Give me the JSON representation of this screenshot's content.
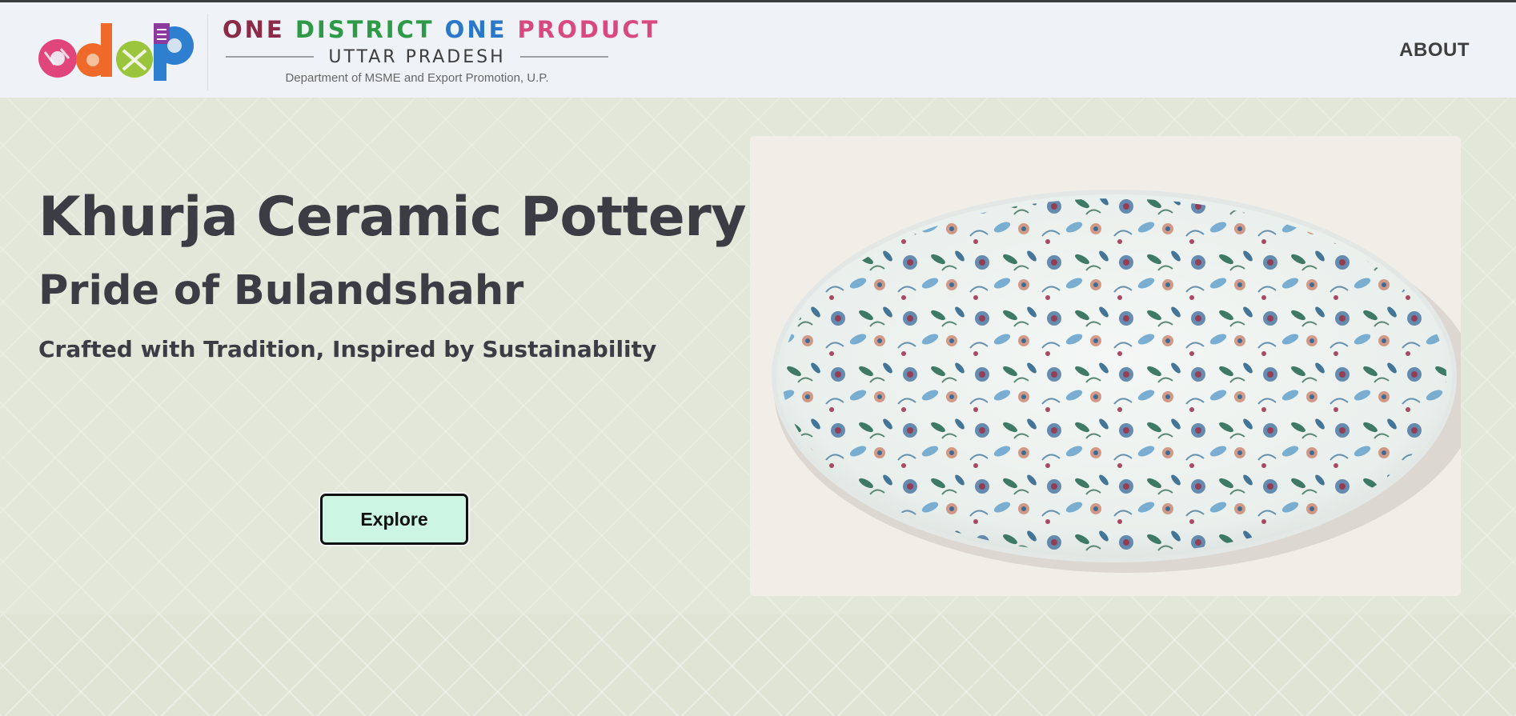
{
  "header": {
    "logo": {
      "mark_text": "odop",
      "line1_words": [
        "ONE",
        "DISTRICT",
        "ONE",
        "PRODUCT"
      ],
      "line2": "UTTAR PRADESH",
      "line3": "Department of MSME and Export Promotion, U.P."
    },
    "nav": {
      "about_label": "ABOUT"
    }
  },
  "hero": {
    "title": "Khurja Ceramic Pottery",
    "subtitle": "Pride of Bulandshahr",
    "tagline": "Crafted with Tradition, Inspired by Sustainability",
    "explore_label": "Explore",
    "image_subject": "floral-ceramic-plate"
  },
  "colors": {
    "header_bg": "#eff3f8",
    "page_bg": "#e2e6d8",
    "text_dark": "#3c3d44",
    "button_bg": "#cdf5e3",
    "logo_word1": "#8b2b4a",
    "logo_word2": "#2e9a48",
    "logo_word3": "#2c78c8",
    "logo_word4": "#d8497f"
  }
}
